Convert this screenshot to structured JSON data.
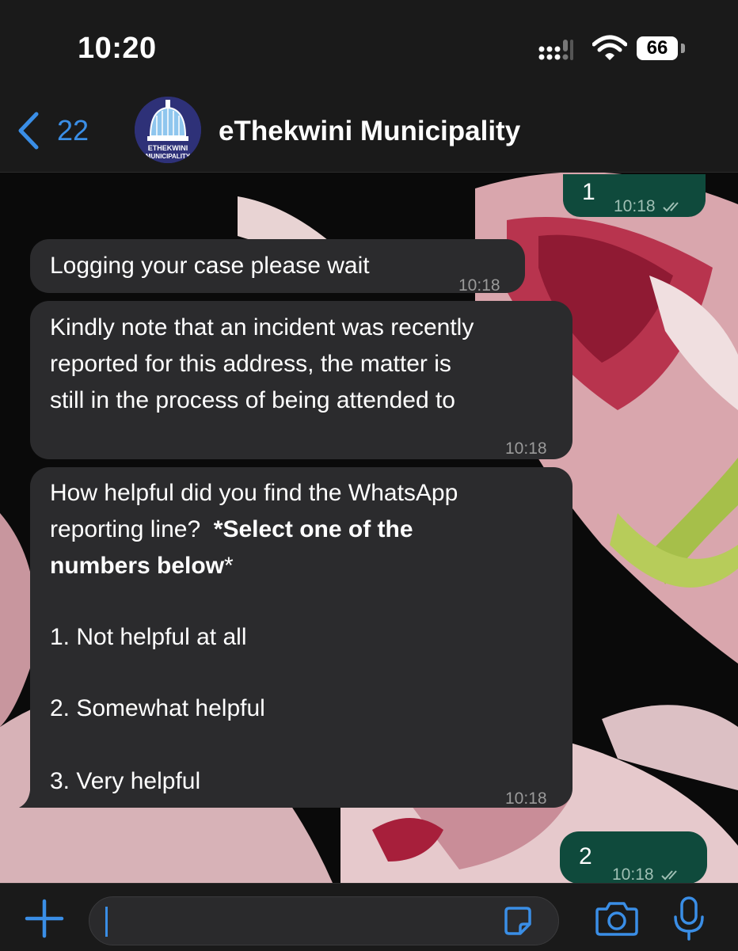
{
  "status_bar": {
    "time": "10:20",
    "battery": "66"
  },
  "header": {
    "back_count": "22",
    "title": "eThekwini Municipality",
    "avatar_text_line1": "ETHEKWINI",
    "avatar_text_line2": "MUNICIPALITY"
  },
  "messages": [
    {
      "direction": "outgoing",
      "text": "1",
      "time": "10:18",
      "status": "read"
    },
    {
      "direction": "incoming",
      "text": "Logging your case please wait",
      "time": "10:18"
    },
    {
      "direction": "incoming",
      "lines": [
        "Kindly note that an incident was recently",
        "reported for this address, the matter is",
        "still in the process of being attended to"
      ],
      "time": "10:18"
    },
    {
      "direction": "incoming",
      "line1": "How helpful did you find the WhatsApp",
      "line2_plain": "reporting line?",
      "line2_bold": "*Select one of the",
      "line3_bold": "numbers below",
      "line3_plain": "*",
      "options": [
        "1. Not helpful at all",
        "2. Somewhat helpful",
        "3. Very helpful"
      ],
      "time": "10:18"
    },
    {
      "direction": "outgoing",
      "text": "2",
      "time": "10:18",
      "status": "read"
    }
  ],
  "composer": {
    "placeholder": ""
  },
  "colors": {
    "accent": "#3a8ee6",
    "incoming_bubble": "#2b2b2d",
    "outgoing_bubble": "#0f4a3c",
    "bar": "#1a1a1a"
  },
  "icons": [
    "chevron-left-icon",
    "plus-icon",
    "sticker-icon",
    "camera-icon",
    "microphone-icon",
    "wifi-icon",
    "signal-icon",
    "battery-icon",
    "read-ticks-icon"
  ]
}
